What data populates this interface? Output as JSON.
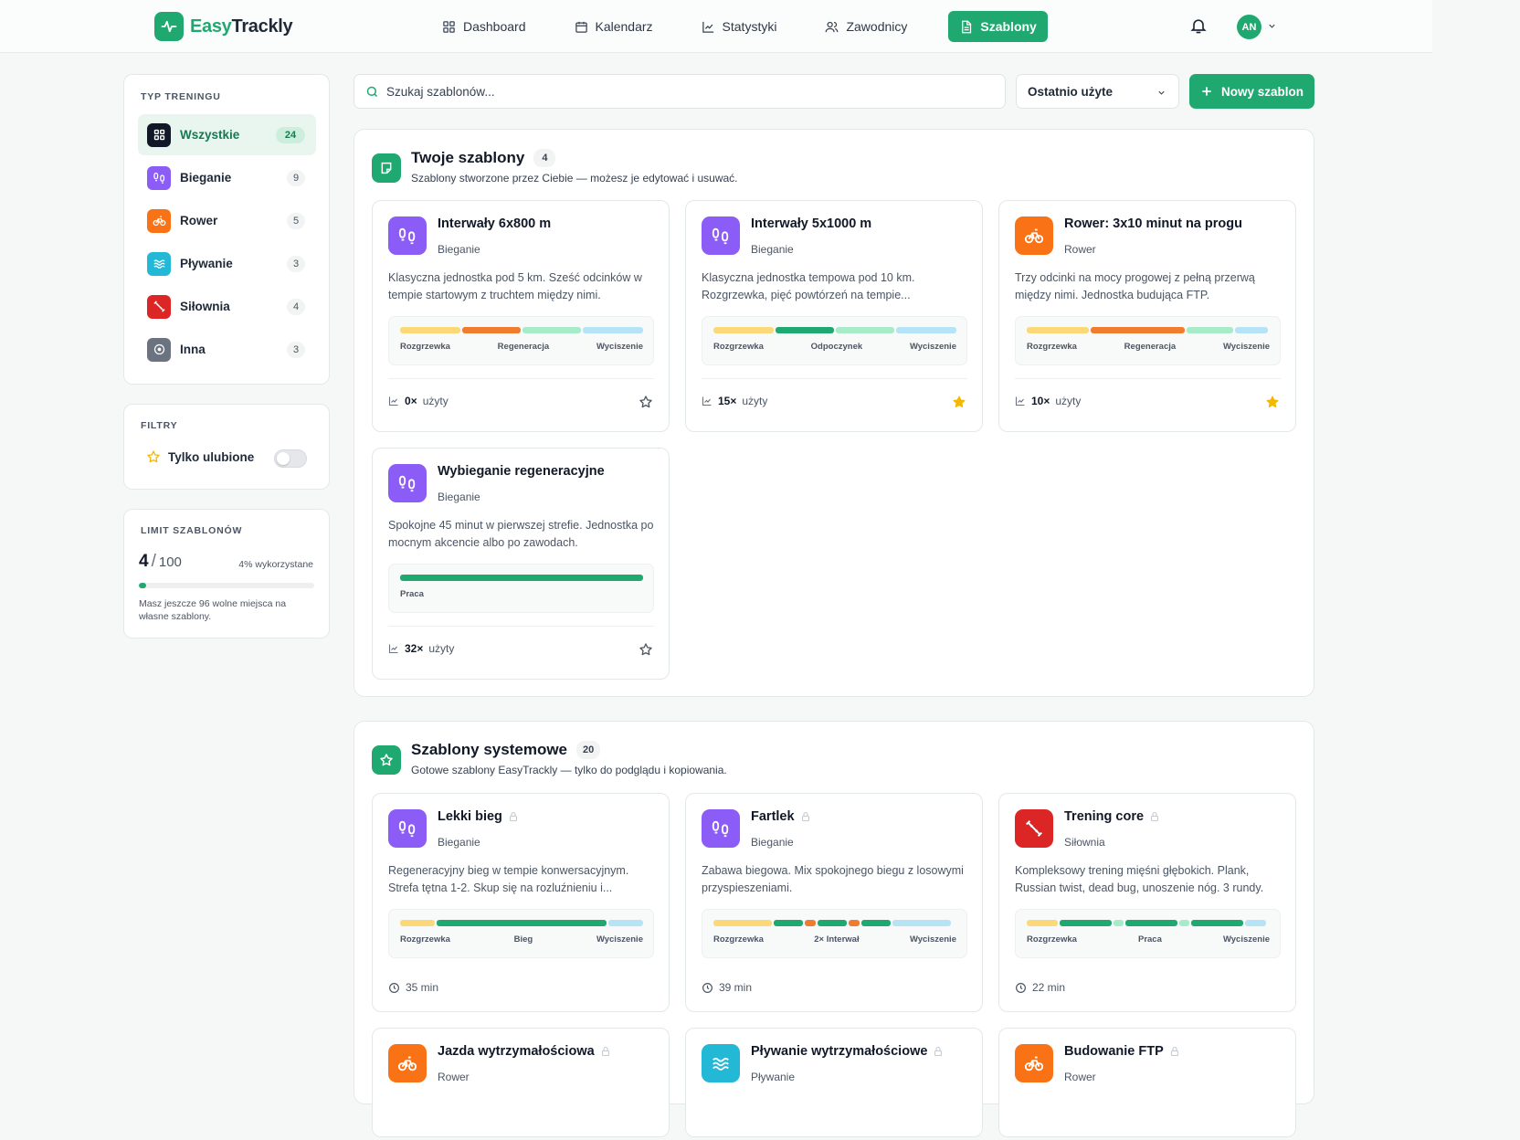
{
  "app": {
    "name_part1": "Easy",
    "name_part2": "Trackly"
  },
  "nav": [
    {
      "label": "Dashboard",
      "icon": "dashboard-icon"
    },
    {
      "label": "Kalendarz",
      "icon": "calendar-icon"
    },
    {
      "label": "Statystyki",
      "icon": "chart-icon"
    },
    {
      "label": "Zawodnicy",
      "icon": "users-icon"
    },
    {
      "label": "Szablony",
      "icon": "document-icon",
      "active": true
    }
  ],
  "user": {
    "initials": "AN"
  },
  "sidebar": {
    "types_title": "TYP TRENINGU",
    "types": [
      {
        "label": "Wszystkie",
        "count": "24",
        "color": "#111827"
      },
      {
        "label": "Bieganie",
        "count": "9",
        "color": "#8b5cf6"
      },
      {
        "label": "Rower",
        "count": "5",
        "color": "#f97316"
      },
      {
        "label": "Pływanie",
        "count": "3",
        "color": "#22b8d6"
      },
      {
        "label": "Siłownia",
        "count": "4",
        "color": "#dc2626"
      },
      {
        "label": "Inna",
        "count": "3",
        "color": "#6b7280"
      }
    ],
    "filters_title": "FILTRY",
    "favorites_label": "Tylko ulubione",
    "favorites_on": false,
    "limit_title": "LIMIT SZABLONÓW",
    "limit_used": "4",
    "limit_sep": "/",
    "limit_max": "100",
    "limit_pct_label": "4% wykorzystane",
    "limit_fraction": 0.04,
    "limit_note": "Masz jeszcze 96 wolne miejsca na własne szablony."
  },
  "toolbar": {
    "search_placeholder": "Szukaj szablonów...",
    "sort_value": "Ostatnio użyte",
    "new_label": "Nowy szablon"
  },
  "own": {
    "title": "Twoje szablony",
    "count": "4",
    "subtitle": "Szablony stworzone przez Ciebie — możesz je edytować i usuwać.",
    "cards": [
      {
        "name": "Interwały 6x800 m",
        "type": "Bieganie",
        "desc": "Klasyczna jednostka pod 5 km. Sześć odcinków w tempie startowym z truchtem między nimi.",
        "labels": [
          "Rozgrzewka",
          "Regeneracja",
          "Wyciszenie"
        ],
        "uses": "0×",
        "uses_label": "użyty",
        "favorite": false
      },
      {
        "name": "Interwały 5x1000 m",
        "type": "Bieganie",
        "desc": "Klasyczna jednostka tempowa pod 10 km. Rozgrzewka, pięć powtórzeń na tempie...",
        "labels": [
          "Rozgrzewka",
          "Odpoczynek",
          "Wyciszenie"
        ],
        "uses": "15×",
        "uses_label": "użyty",
        "favorite": true
      },
      {
        "name": "Rower: 3x10 minut na progu",
        "type": "Rower",
        "desc": "Trzy odcinki na mocy progowej z pełną przerwą między nimi. Jednostka budująca FTP.",
        "labels": [
          "Rozgrzewka",
          "Regeneracja",
          "Wyciszenie"
        ],
        "uses": "10×",
        "uses_label": "użyty",
        "favorite": true
      },
      {
        "name": "Wybieganie regeneracyjne",
        "type": "Bieganie",
        "desc": "Spokojne 45 minut w pierwszej strefie. Jednostka po mocnym akcencie albo po zawodach.",
        "labels": [
          "Praca"
        ],
        "uses": "32×",
        "uses_label": "użyty",
        "favorite": false
      }
    ]
  },
  "system": {
    "title": "Szablony systemowe",
    "count": "20",
    "subtitle": "Gotowe szablony EasyTrackly — tylko do podglądu i kopiowania.",
    "cards": [
      {
        "name": "Lekki bieg",
        "type": "Bieganie",
        "desc": "Regeneracyjny bieg w tempie konwersacyjnym. Strefa tętna 1-2. Skup się na rozluźnieniu i...",
        "labels": [
          "Rozgrzewka",
          "Bieg",
          "Wyciszenie"
        ],
        "duration": "35 min"
      },
      {
        "name": "Fartlek",
        "type": "Bieganie",
        "desc": "Zabawa biegowa. Mix spokojnego biegu z losowymi przyspieszeniami.",
        "labels": [
          "Rozgrzewka",
          "2× Interwał",
          "Wyciszenie"
        ],
        "duration": "39 min"
      },
      {
        "name": "Trening core",
        "type": "Siłownia",
        "desc": "Kompleksowy trening mięśni głębokich. Plank, Russian twist, dead bug, unoszenie nóg. 3 rundy.",
        "labels": [
          "Rozgrzewka",
          "Praca",
          "Wyciszenie"
        ],
        "duration": "22 min"
      },
      {
        "name": "Jazda wytrzymałościowa",
        "type": "Rower"
      },
      {
        "name": "Pływanie wytrzymałościowe",
        "type": "Pływanie"
      },
      {
        "name": "Budowanie FTP",
        "type": "Rower"
      }
    ]
  },
  "colors": {
    "brand": "#1fa971",
    "warmup": "#fcd978",
    "recovery": "#f07c2e",
    "rest": "#a7ebc9",
    "cooldown": "#b7e3f6",
    "work": "#1fa971",
    "star": "#f5b800"
  }
}
